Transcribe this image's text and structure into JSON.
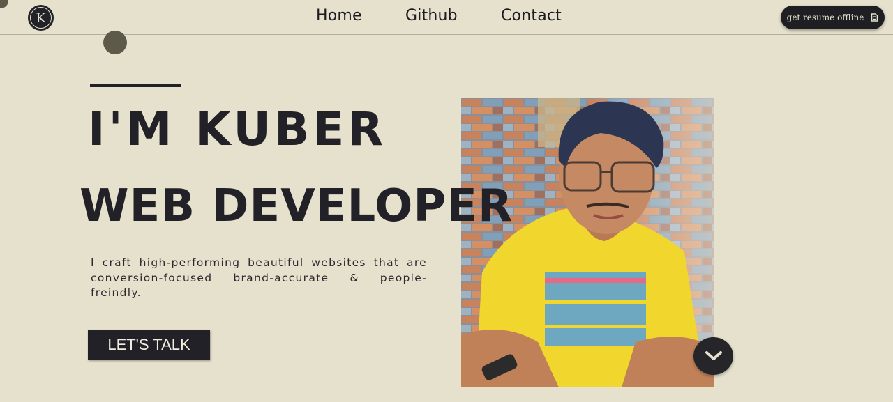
{
  "brand": {
    "logo_letter": "K",
    "logo_icon": "k-circle-logo-icon"
  },
  "nav": {
    "items": [
      {
        "label": "Home"
      },
      {
        "label": "Github"
      },
      {
        "label": "Contact"
      }
    ]
  },
  "resume_button": {
    "label": "get resume offline",
    "icon": "document-icon"
  },
  "hero": {
    "title_line1": "I'M KUBER",
    "title_line2": "WEB DEVELOPER",
    "tagline": "I craft high-performing beautiful websites that are conversion-focused brand-accurate & people-freindly.",
    "cta_label": "LET'S TALK"
  },
  "scroll_button": {
    "icon": "chevron-down-icon"
  },
  "colors": {
    "background": "#e6e1cd",
    "text_dark": "#222127",
    "accent_dot": "#5d5a49",
    "button_bg": "#1f1e23",
    "button_text": "#e6e1cd"
  }
}
